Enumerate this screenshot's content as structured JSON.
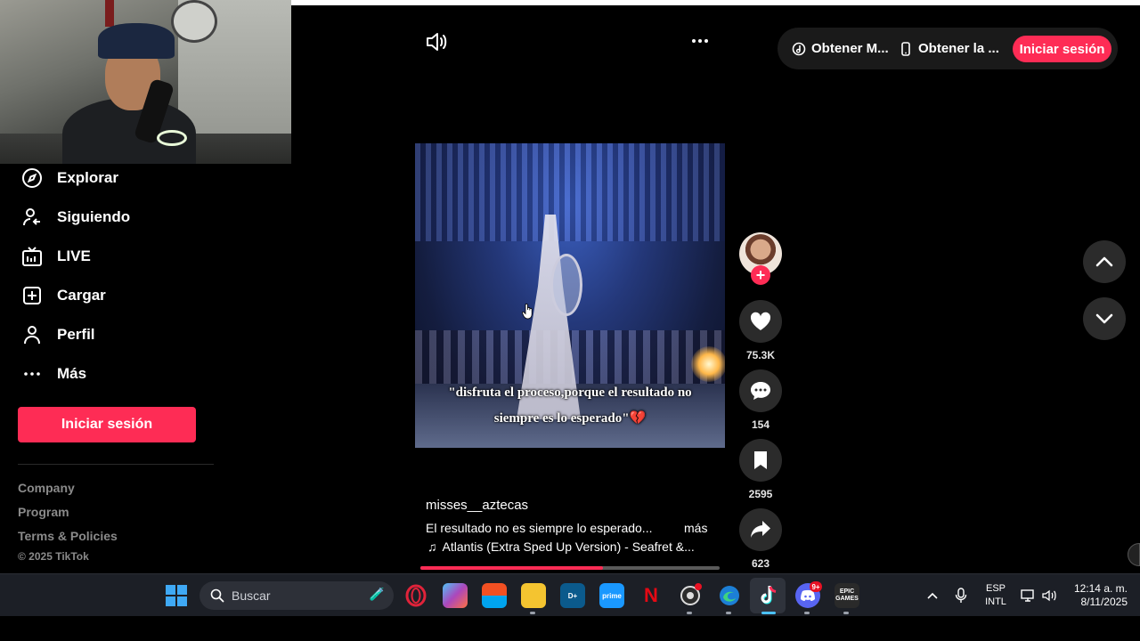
{
  "sidebar": {
    "items": [
      {
        "label": "Explorar",
        "icon": "compass-icon"
      },
      {
        "label": "Siguiendo",
        "icon": "following-icon"
      },
      {
        "label": "LIVE",
        "icon": "live-tv-icon"
      },
      {
        "label": "Cargar",
        "icon": "upload-plus-icon"
      },
      {
        "label": "Perfil",
        "icon": "profile-icon"
      },
      {
        "label": "Más",
        "icon": "more-dots-icon"
      }
    ],
    "login_label": "Iniciar sesión",
    "footer_links": [
      "Company",
      "Program",
      "Terms & Policies"
    ],
    "copyright": "© 2025 TikTok"
  },
  "top_pill": {
    "item1": "Obtener M...",
    "item2": "Obtener la ...",
    "login_label": "Iniciar sesión"
  },
  "video": {
    "caption_line1": "\"disfruta el proceso,porque el resultado no",
    "caption_line2": "siempre es lo esperado\"💔",
    "author": "misses__aztecas",
    "description": "El resultado no es siempre lo esperado...",
    "more_label": "más",
    "music": "Atlantis (Extra Sped Up Version) - Seafret &...",
    "progress_fraction": 0.61
  },
  "actions": {
    "likes": "75.3K",
    "comments": "154",
    "saves": "2595",
    "shares": "623"
  },
  "taskbar": {
    "search_placeholder": "Buscar",
    "discord_badge": "9+",
    "lang_line1": "ESP",
    "lang_line2": "INTL",
    "time": "12:14 a. m.",
    "date": "8/11/2025"
  },
  "colors": {
    "accent": "#fe2c55",
    "background": "#000000",
    "button_bg": "#2b2b2b",
    "taskbar_bg": "#1c1f26"
  }
}
